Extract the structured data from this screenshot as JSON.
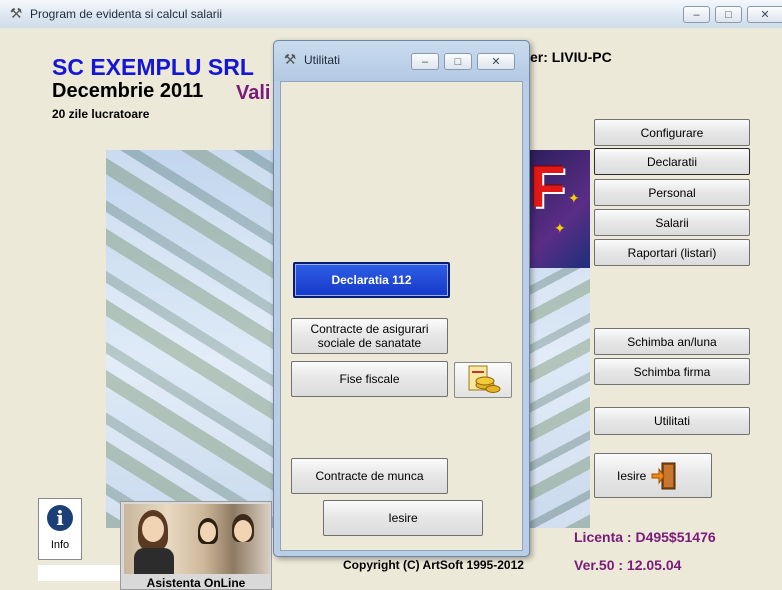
{
  "window": {
    "title": "Program de evidenta si calcul salarii",
    "controls": {
      "minimize": "–",
      "maximize": "□",
      "close": "✕"
    }
  },
  "header": {
    "company": "SC EXEMPLU SRL",
    "period": "Decembrie 2011",
    "valid_fragment": "Vali",
    "user_fragment": "er: LIVIU-PC",
    "working_days": "20 zile lucratoare"
  },
  "menu": {
    "configurare": "Configurare",
    "declaratii": "Declaratii",
    "personal": "Personal",
    "salarii": "Salarii",
    "raportari": "Raportari (listari)",
    "schimba_an": "Schimba an/luna",
    "schimba_firma": "Schimba firma",
    "utilitati": "Utilitati",
    "iesire": "Iesire"
  },
  "footer": {
    "licenta": "Licenta :  D495$51476",
    "version": "Ver.50  :  12.05.04",
    "copyright": "Copyright (C) ArtSoft 1995-2012",
    "info": "Info",
    "asistenta": "Asistenta OnLine"
  },
  "dialog": {
    "title": "Utilitati",
    "declaratia_112": "Declaratia 112",
    "contracte_asigurari_line1": "Contracte de asigurari",
    "contracte_asigurari_line2": "sociale de sanatate",
    "fise_fiscale": "Fise fiscale",
    "contracte_munca": "Contracte de munca",
    "iesire": "Iesire"
  },
  "icons": {
    "app": "gear-tools-icon",
    "info": "info-icon",
    "exit": "exit-door-icon",
    "fise": "coins-document-icon"
  },
  "colors": {
    "company": "#1515d6",
    "licenta": "#7a1a7a",
    "declaratia_112_bg": "#1538c8"
  }
}
